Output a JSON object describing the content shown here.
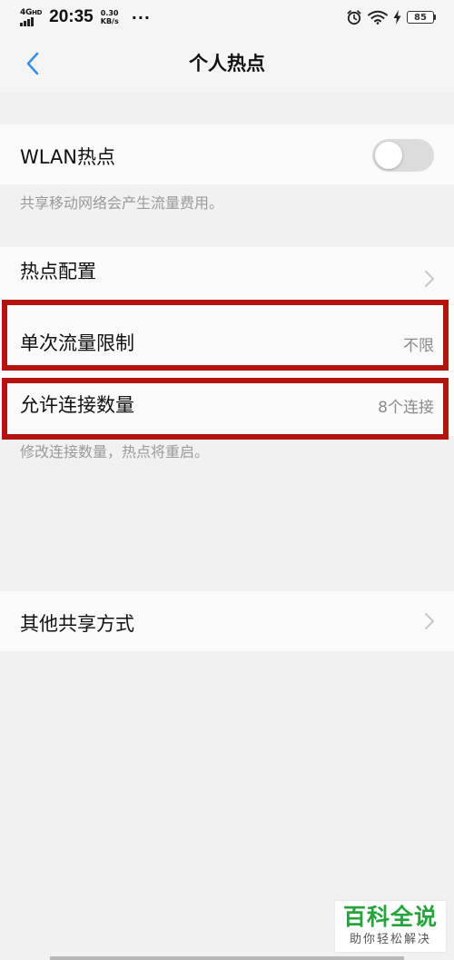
{
  "status_bar": {
    "network_type": "4G",
    "network_sub": "HD",
    "time": "20:35",
    "speed_value": "0.30",
    "speed_unit": "KB/s",
    "more": "···",
    "battery_level": "85"
  },
  "header": {
    "title": "个人热点",
    "back_icon": "chevron-left-icon"
  },
  "wlan_hotspot": {
    "label": "WLAN热点",
    "enabled": false,
    "note": "共享移动网络会产生流量费用。"
  },
  "hotspot_config": {
    "label": "热点配置"
  },
  "data_limit": {
    "label": "单次流量限制",
    "value": "不限"
  },
  "connection_count": {
    "label": "允许连接数量",
    "value": "8个连接",
    "note": "修改连接数量，热点将重启。"
  },
  "other_sharing": {
    "label": "其他共享方式"
  },
  "watermark": {
    "main": "百科全说",
    "sub": "助你轻松解决"
  },
  "colors": {
    "accent": "#3a8ee6",
    "highlight": "#b5130e",
    "watermark_green": "#27a33c",
    "background": "#f1f1f1",
    "row_background": "#fafafa"
  }
}
